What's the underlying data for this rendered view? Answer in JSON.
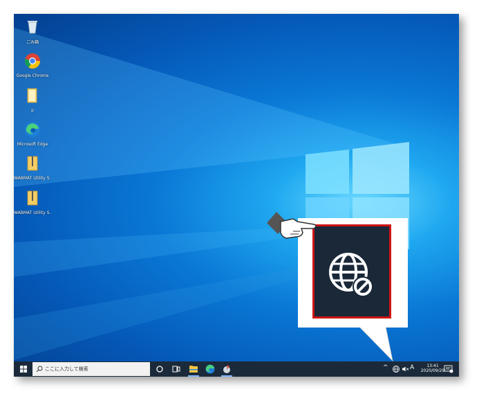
{
  "desktop_icons": [
    {
      "label": "ごみ箱",
      "icon": "recycle-bin-icon"
    },
    {
      "label": "Google Chrome",
      "icon": "chrome-icon"
    },
    {
      "label": "p",
      "icon": "folder-icon"
    },
    {
      "label": "Microsoft Edge",
      "icon": "edge-icon"
    },
    {
      "label": "WABMAT Utility S...",
      "icon": "zip-folder-icon"
    },
    {
      "label": "WABMAT Utility S...",
      "icon": "zip-folder-icon"
    }
  ],
  "taskbar": {
    "search_placeholder": "ここに入力して検索",
    "ime": "A",
    "time": "13:41",
    "date": "2020/09/29"
  },
  "callout": {
    "highlighted_icon": "network-globe-disconnected-icon",
    "pointer_icon": "pointing-hand-icon"
  },
  "colors": {
    "highlight_border": "#d01414",
    "taskbar": "#1b2a3a"
  }
}
